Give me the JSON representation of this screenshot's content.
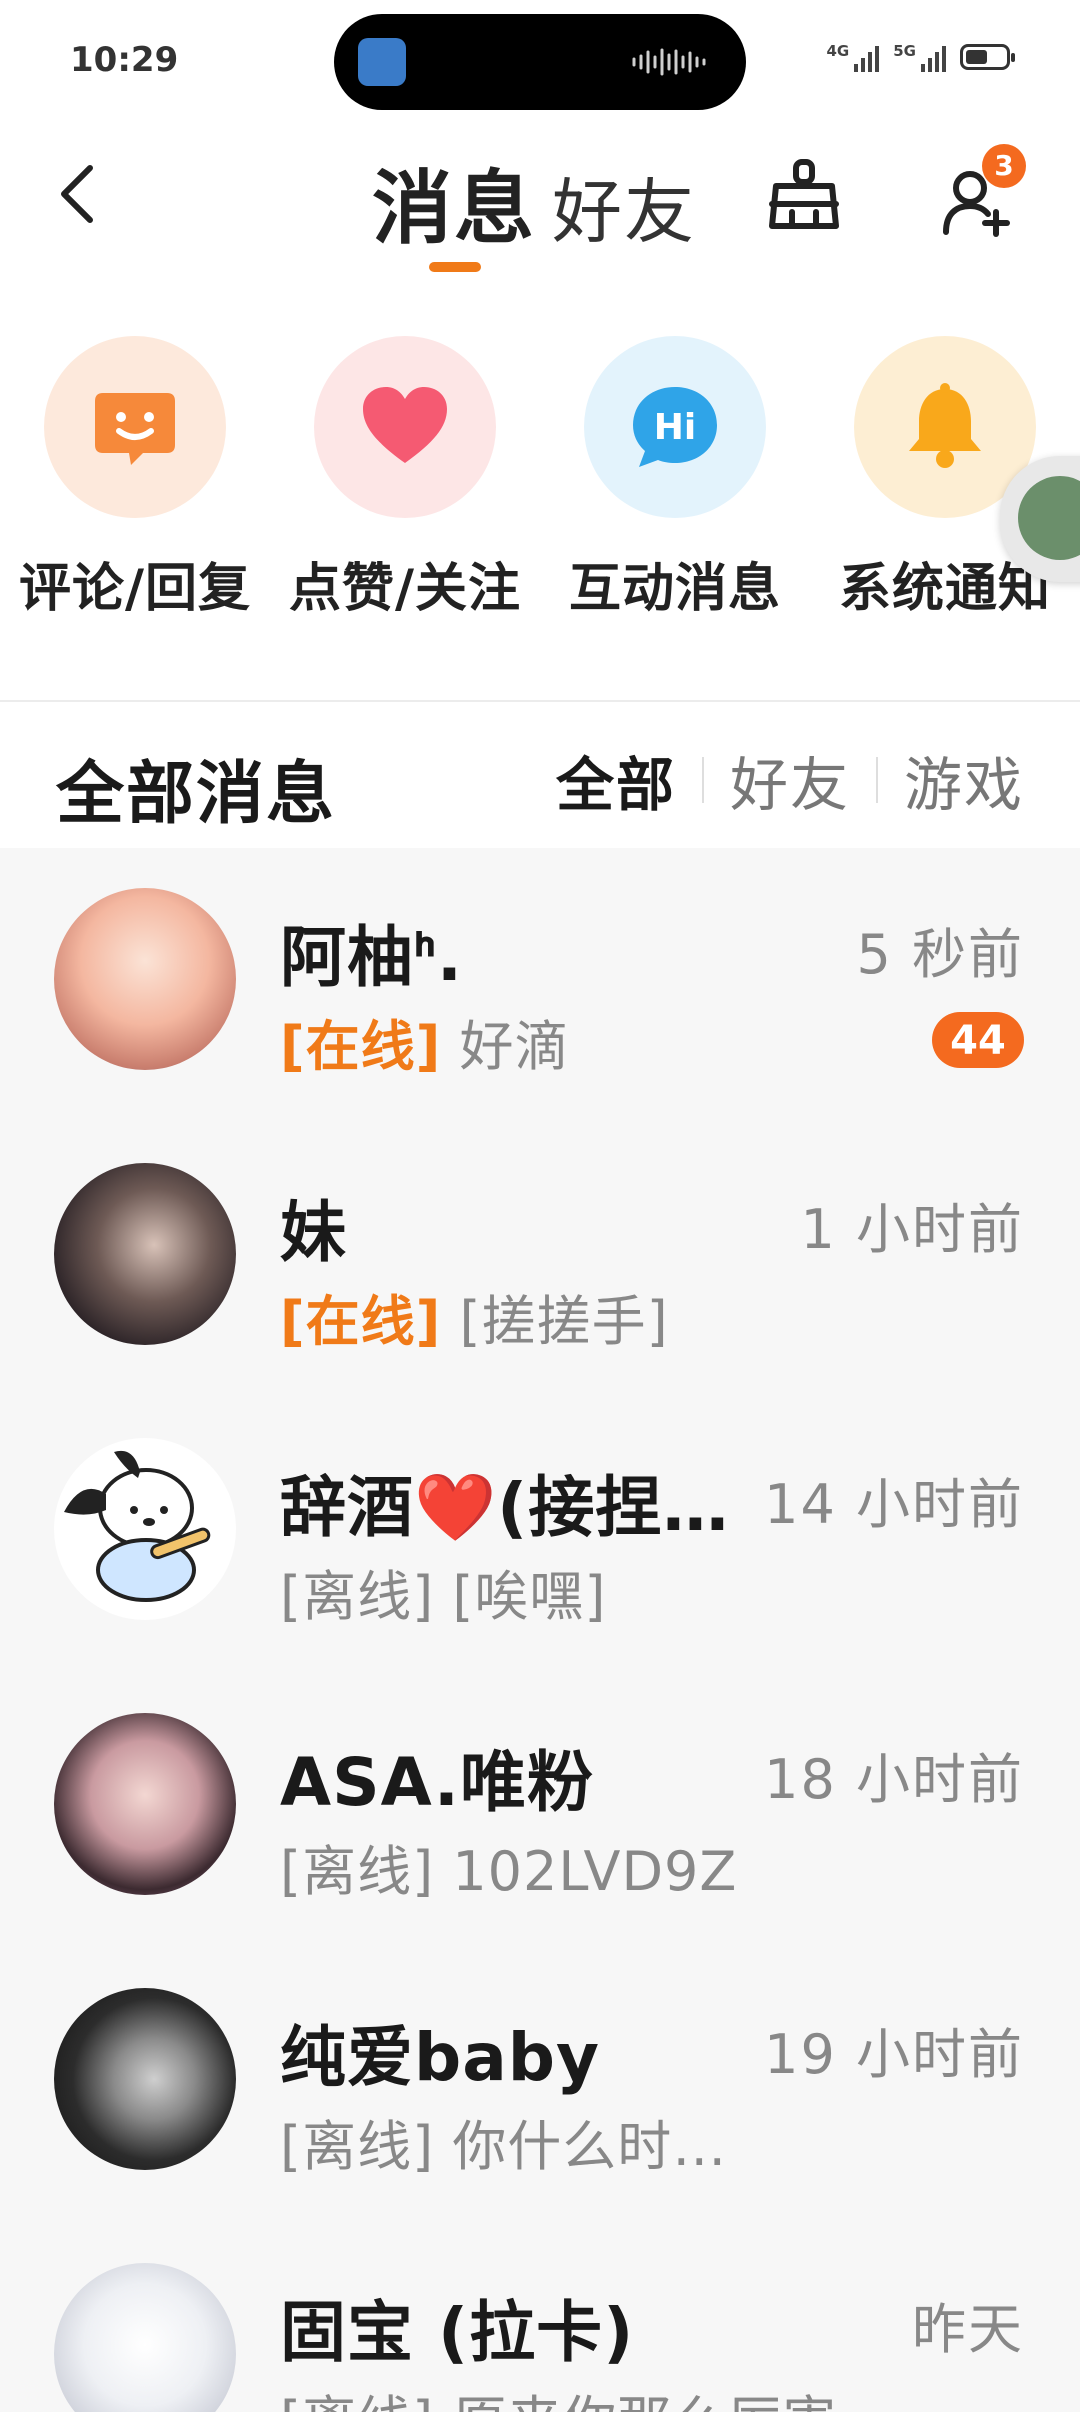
{
  "status_bar": {
    "time": "10:29",
    "net1": "4G",
    "net2": "5G",
    "battery_level": 0.55
  },
  "header": {
    "tabs": [
      {
        "label": "消息",
        "active": true
      },
      {
        "label": "好友",
        "active": false
      }
    ],
    "add_friend_badge": "3",
    "accent": "#f07a18"
  },
  "shortcuts": [
    {
      "label": "评论/回复",
      "icon": "smile-chat-icon",
      "bg": "#fde9dc",
      "color": "#f6893a"
    },
    {
      "label": "点赞/关注",
      "icon": "heart-icon",
      "bg": "#fde6e6",
      "color": "#f55a72"
    },
    {
      "label": "互动消息",
      "icon": "hi-bubble-icon",
      "bg": "#e3f3fc",
      "color": "#2fa4e8"
    },
    {
      "label": "系统通知",
      "icon": "bell-icon",
      "bg": "#fdeed3",
      "color": "#f9a81b"
    }
  ],
  "filter": {
    "title": "全部消息",
    "tabs": [
      {
        "label": "全部",
        "active": true
      },
      {
        "label": "好友",
        "active": false
      },
      {
        "label": "游戏",
        "active": false
      }
    ]
  },
  "conversations": [
    {
      "name": "阿柚ᑋ.",
      "time": "5 秒前",
      "status": "[在线]",
      "online": true,
      "preview": "好滴",
      "unread": "44"
    },
    {
      "name": "妹",
      "time": "1 小时前",
      "status": "[在线]",
      "online": true,
      "preview": "[搓搓手]",
      "unread": ""
    },
    {
      "name": "辞酒❤️(接捏…",
      "time": "14 小时前",
      "status": "[离线]",
      "online": false,
      "preview": "[唉嘿]",
      "unread": ""
    },
    {
      "name": "ASA.唯粉",
      "time": "18 小时前",
      "status": "[离线]",
      "online": false,
      "preview": "102LVD9Z",
      "unread": ""
    },
    {
      "name": "纯爱baby",
      "time": "19 小时前",
      "status": "[离线]",
      "online": false,
      "preview": "你什么时…",
      "unread": ""
    },
    {
      "name": "固宝 (拉卡)",
      "time": "昨天",
      "status": "[离线]",
      "online": false,
      "preview": "原来你那么厉害",
      "unread": ""
    }
  ]
}
